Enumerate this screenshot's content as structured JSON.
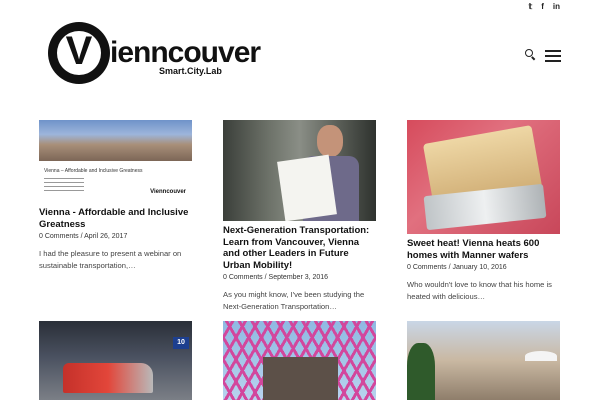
{
  "brand": {
    "name": "ienncouver",
    "emblem_letter": "V",
    "tagline": "Smart.City.Lab"
  },
  "social": [
    "twitter-icon",
    "facebook-icon",
    "linkedin-icon"
  ],
  "social_glyphs": [
    "𝕥",
    "f",
    "in"
  ],
  "posts": [
    {
      "title": "Vienna - Affordable and Inclusive Greatness",
      "comments": "0 Comments",
      "date": "April 26, 2017",
      "excerpt": "I had the pleasure to present a webinar on sustainable transportation,…",
      "slide_title": "Vienna – Affordable and Inclusive Greatness",
      "slide_logo": "Vienncouver"
    },
    {
      "title": "Next-Generation Transportation: Learn from Vancouver, Vienna and other Leaders in Future Urban Mobility!",
      "comments": "0 Comments",
      "date": "September 3, 2016",
      "excerpt": "As you might know, I've been studying the Next-Generation Transportation…"
    },
    {
      "title": "Sweet heat! Vienna heats 600 homes with Manner wafers",
      "comments": "0 Comments",
      "date": "January 10, 2016",
      "excerpt": "Who wouldn't love to know that his home is heated with delicious…"
    },
    {
      "title": "",
      "platform_sign": "10"
    },
    {
      "title": ""
    },
    {
      "title": ""
    }
  ],
  "meta_separator": " / "
}
